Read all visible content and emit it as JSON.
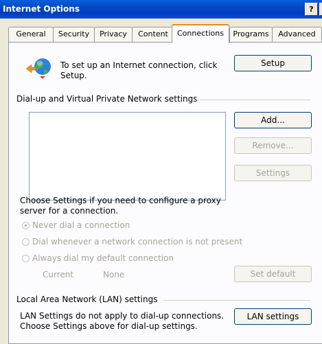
{
  "window": {
    "title": "Internet Options",
    "help_label": "?"
  },
  "tabs": [
    "General",
    "Security",
    "Privacy",
    "Content",
    "Connections",
    "Programs",
    "Advanced"
  ],
  "active_tab": "Connections",
  "setup": {
    "text": "To set up an Internet connection, click Setup.",
    "button": "Setup"
  },
  "dialup": {
    "group_label": "Dial-up and Virtual Private Network settings",
    "items": [],
    "add_label": "Add...",
    "remove_label": "Remove...",
    "settings_label": "Settings"
  },
  "proxy_text": "Choose Settings if you need to configure a proxy server for a connection.",
  "dial_options": [
    {
      "label": "Never dial a connection",
      "selected": true
    },
    {
      "label": "Dial whenever a network connection is not present",
      "selected": false
    },
    {
      "label": "Always dial my default connection",
      "selected": false
    }
  ],
  "default": {
    "current_label": "Current",
    "current_value": "None",
    "set_default_label": "Set default"
  },
  "lan": {
    "group_label": "Local Area Network (LAN) settings",
    "text": "LAN Settings do not apply to dial-up connections. Choose Settings above for dial-up settings.",
    "button": "LAN settings"
  }
}
